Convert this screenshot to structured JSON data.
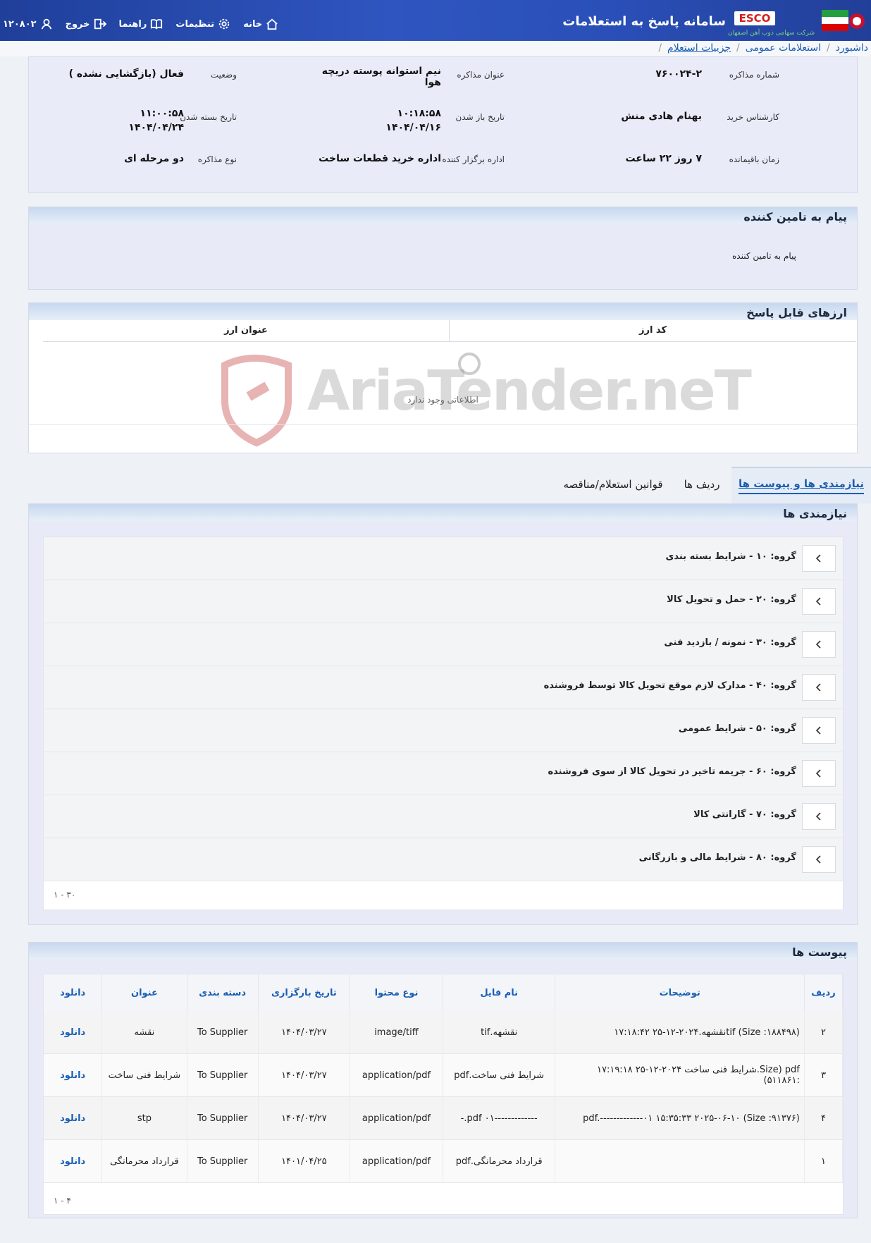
{
  "header": {
    "title": "سامانه پاسخ به استعلامات",
    "brand": "ESCO",
    "brand_sub": "شرکت سهامی ذوب آهن اصفهان",
    "tools": [
      {
        "label": "خانه",
        "icon": "home-icon"
      },
      {
        "label": "تنظیمات",
        "icon": "gear-icon"
      },
      {
        "label": "راهنما",
        "icon": "book-icon"
      },
      {
        "label": "خروج",
        "icon": "logout-icon"
      }
    ],
    "user_id": "۱۲۰۸۰۲",
    "colors": {
      "bar": "#2a4fb8",
      "brand_red": "#d31f1f"
    }
  },
  "breadcrumb": [
    {
      "label": "داشبورد"
    },
    {
      "label": "استعلامات عمومی"
    },
    {
      "label": "جزییات استعلام"
    }
  ],
  "info": {
    "negotiation_number_label": "شماره مذاکره",
    "negotiation_number": "۷۶۰۰۲۴-۲",
    "negotiation_title_label": "عنوان مذاکره",
    "negotiation_title": "نیم استوانه پوسته دریچه هوا",
    "status_label": "وضعیت",
    "status": "فعال (بازگشایی نشده )",
    "buyer_label": "کارشناس خرید",
    "buyer": "بهنام هادی منش",
    "open_date_label": "تاریخ باز شدن",
    "open_time": "۱۰:۱۸:۵۸",
    "open_date": "۱۴۰۴/۰۴/۱۶",
    "close_date_label": "تاریخ بسته شدن",
    "close_time": "۱۱:۰۰:۵۸",
    "close_date": "۱۴۰۴/۰۴/۲۴",
    "remaining_label": "زمان باقیمانده",
    "remaining": "۷ روز ۲۲ ساعت",
    "organizer_label": "اداره برگزار کننده",
    "organizer": "اداره خرید قطعات ساخت",
    "type_label": "نوع مذاکره",
    "type": "دو مرحله ای"
  },
  "supplier_message": {
    "title": "پیام به تامین کننده",
    "text": "پیام به تامین کننده"
  },
  "currencies": {
    "title": "ارزهای قابل پاسخ",
    "columns": [
      "کد ارز",
      "عنوان ارز"
    ],
    "empty": "اطلاعاتی وجود ندارد"
  },
  "watermark": "AriaTender.neT",
  "tabs": [
    {
      "label": "نیازمندی ها و پیوست ها",
      "active": true
    },
    {
      "label": "ردیف ها",
      "active": false
    },
    {
      "label": "قوانین استعلام/مناقصه",
      "active": false
    }
  ],
  "requirements": {
    "title": "نیازمندی ها",
    "groups": [
      "گروه: ۱۰ - شرایط بسته بندی",
      "گروه: ۲۰ - حمل و تحویل کالا",
      "گروه: ۳۰ - نمونه / بازدید فنی",
      "گروه: ۴۰ - مدارک لازم موقع تحویل کالا توسط فروشنده",
      "گروه: ۵۰ - شرایط عمومی",
      "گروه: ۶۰ - جریمه تاخیر در تحویل کالا از سوی فروشنده",
      "گروه: ۷۰ - گارانتی کالا",
      "گروه: ۸۰ - شرایط مالی و بازرگانی"
    ],
    "pagination": "۱ - ۳۰"
  },
  "attachments": {
    "title": "پیوست ها",
    "columns": [
      "ردیف",
      "توضیحات",
      "نام فایل",
      "نوع محتوا",
      "تاریخ بارگزاری",
      "دسته بندی",
      "عنوان",
      "دانلود"
    ],
    "rows": [
      [
        "۲",
        "tif (Size :۱۸۸۴۹۸)نقشهه.۲۰۲۴-۱۲-۲۵ ۱۷:۱۸:۴۲",
        "نقشهه.tif",
        "image/tiff",
        "۱۴۰۴/۰۳/۲۷",
        "To Supplier",
        "نقشه",
        "دانلود"
      ],
      [
        "۳",
        "pdf (Size.شرایط فنی ساخت ۲۰۲۴-۱۲-۲۵ ۱۷:۱۹:۱۸ :۵۱۱۸۶۱)",
        "شرایط فنی ساخت.pdf",
        "application/pdf",
        "۱۴۰۴/۰۳/۲۷",
        "To Supplier",
        "شرایط فنی ساخت",
        "دانلود"
      ],
      [
        "۴",
        "pdf.-------------۰۱ ۱۵:۳۵:۳۳ ۲۰۲۵-۰۶-۱۰ (Size :۹۱۳۷۶)",
        "-------------۰۱ pdf.-",
        "application/pdf",
        "۱۴۰۴/۰۳/۲۷",
        "To Supplier",
        "stp",
        "دانلود"
      ],
      [
        "۱",
        "",
        "قرارداد محرمانگی.pdf",
        "application/pdf",
        "۱۴۰۱/۰۴/۲۵",
        "To Supplier",
        "قرارداد محرمانگی",
        "دانلود"
      ]
    ],
    "pagination": "۱ - ۴"
  }
}
